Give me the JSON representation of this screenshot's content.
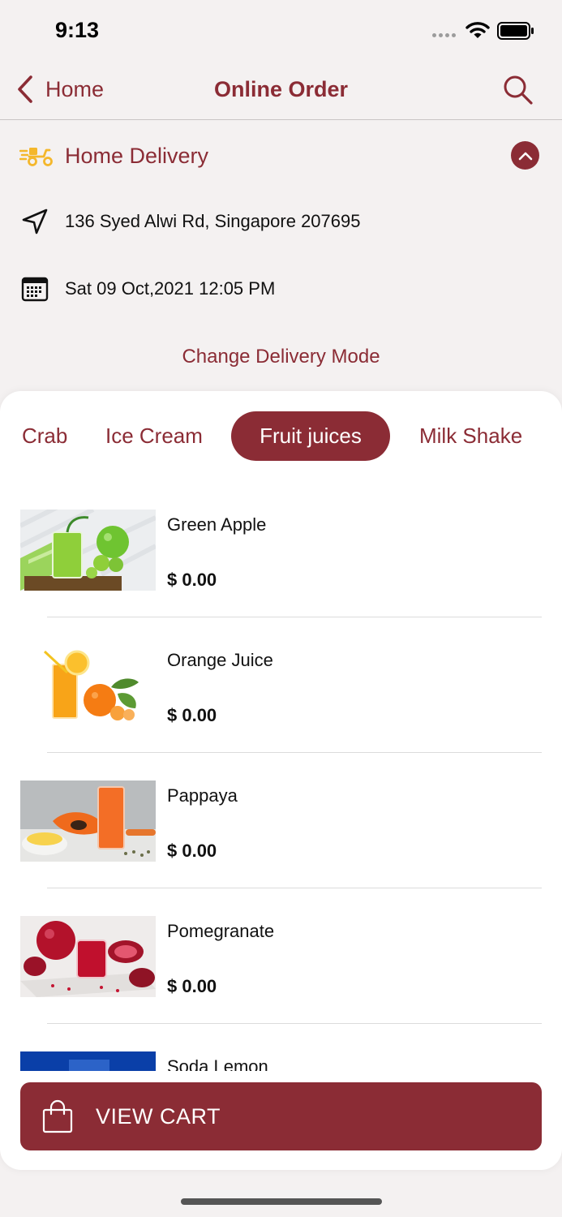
{
  "status_bar": {
    "time": "9:13"
  },
  "nav": {
    "back_label": "Home",
    "title": "Online Order"
  },
  "delivery": {
    "mode": "Home Delivery",
    "address": "136 Syed Alwi Rd, Singapore 207695",
    "datetime": "Sat 09 Oct,2021 12:05 PM",
    "change_mode_label": "Change Delivery Mode"
  },
  "tabs": [
    {
      "label": "Crab",
      "active": false
    },
    {
      "label": "Ice Cream",
      "active": false
    },
    {
      "label": "Fruit juices",
      "active": true
    },
    {
      "label": "Milk Shake",
      "active": false
    }
  ],
  "products": [
    {
      "name": "Green Apple",
      "price": "$ 0.00",
      "image": "green-apple-juice"
    },
    {
      "name": "Orange Juice",
      "price": "$ 0.00",
      "image": "orange-juice"
    },
    {
      "name": "Pappaya",
      "price": "$ 0.00",
      "image": "papaya-juice"
    },
    {
      "name": "Pomegranate",
      "price": "$ 0.00",
      "image": "pomegranate-juice"
    },
    {
      "name": "Soda Lemon",
      "price": "",
      "image": "soda-lemon"
    }
  ],
  "cart": {
    "label": "VIEW CART"
  },
  "colors": {
    "accent": "#8b2c35",
    "background": "#f4f1f1",
    "delivery_icon": "#f4b72b"
  },
  "icons": [
    "back-chevron-icon",
    "search-icon",
    "delivery-scooter-icon",
    "chevron-up-icon",
    "navigation-arrow-icon",
    "calendar-icon",
    "shopping-bag-icon"
  ]
}
